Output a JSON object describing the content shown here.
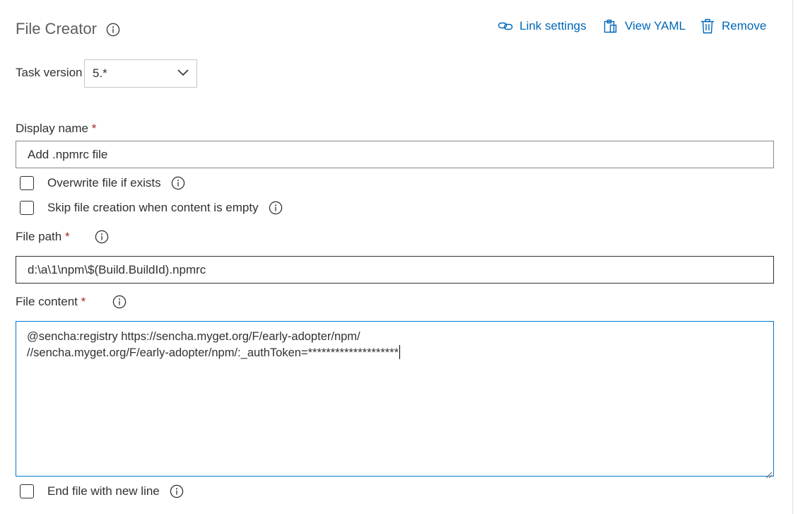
{
  "header": {
    "title": "File Creator",
    "actions": {
      "link_settings": "Link settings",
      "view_yaml": "View YAML",
      "remove": "Remove"
    }
  },
  "task_version": {
    "label": "Task version",
    "selected": "5.*"
  },
  "display_name": {
    "label": "Display name",
    "required_mark": "*",
    "value": "Add .npmrc file"
  },
  "options": {
    "overwrite": {
      "label": "Overwrite file if exists",
      "checked": false
    },
    "skip_empty": {
      "label": "Skip file creation when content is empty",
      "checked": false
    },
    "end_newline": {
      "label": "End file with new line",
      "checked": false
    }
  },
  "file_path": {
    "label": "File path",
    "required_mark": "*",
    "value": "d:\\a\\1\\npm\\$(Build.BuildId).npmrc"
  },
  "file_content": {
    "label": "File content",
    "required_mark": "*",
    "lines": [
      "@sencha:registry https://sencha.myget.org/F/early-adopter/npm/",
      "//sencha.myget.org/F/early-adopter/npm/:_authToken=********************"
    ]
  },
  "colors": {
    "accent": "#0067b8",
    "focus_border": "#0078d4",
    "required": "#a4262c",
    "title": "#605e5c"
  }
}
